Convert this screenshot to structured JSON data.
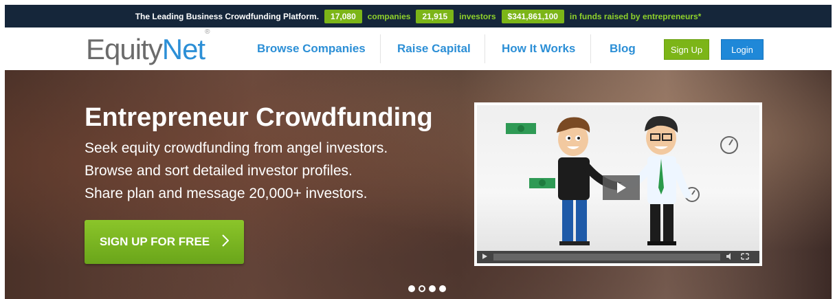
{
  "topbar": {
    "tagline": "The Leading Business Crowdfunding Platform.",
    "companies_count": "17,080",
    "companies_label": "companies",
    "investors_count": "21,915",
    "investors_label": "investors",
    "funds_amount": "$341,861,100",
    "funds_label": "in funds raised by entrepreneurs*"
  },
  "header": {
    "logo_equity": "Equity",
    "logo_net": "Net",
    "logo_reg": "®",
    "nav": [
      {
        "label": "Browse Companies"
      },
      {
        "label": "Raise Capital"
      },
      {
        "label": "How It Works"
      },
      {
        "label": "Blog"
      }
    ],
    "signup_label": "Sign Up",
    "login_label": "Login"
  },
  "hero": {
    "title": "Entrepreneur Crowdfunding",
    "lines": [
      "Seek equity crowdfunding from angel investors.",
      "Browse and sort detailed investor profiles.",
      "Share plan and message 20,000+ investors."
    ],
    "cta_label": "SIGN UP FOR FREE",
    "carousel": {
      "count": 4,
      "active_index": 1
    }
  },
  "colors": {
    "topbar_bg": "#15263a",
    "brand_green": "#7cb518",
    "brand_blue": "#2c8fd6"
  }
}
